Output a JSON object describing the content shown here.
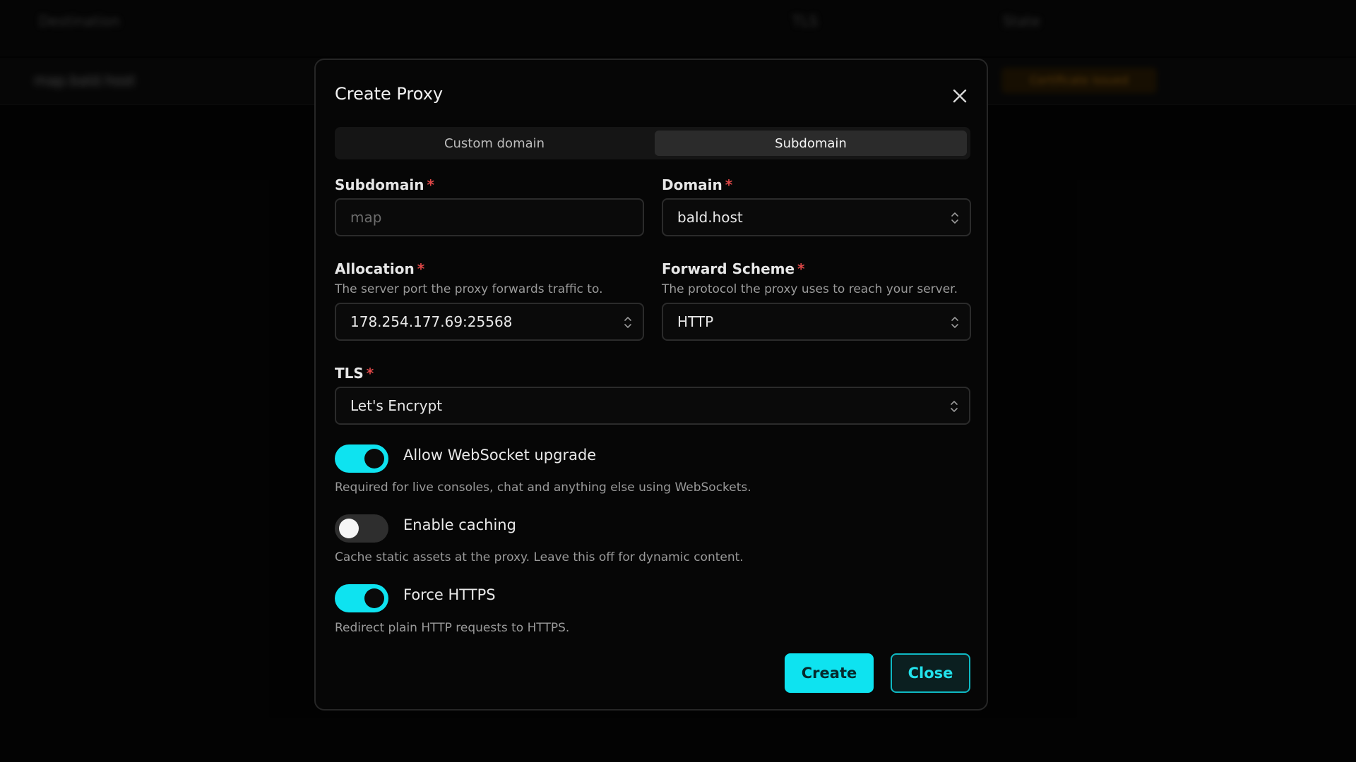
{
  "background": {
    "columns": [
      "Destination",
      "TLS",
      "State"
    ],
    "row_text": "map.bald.host",
    "row_badge": "Certificate Issued"
  },
  "modal": {
    "title": "Create Proxy",
    "close_icon": "close-icon",
    "tabs": [
      {
        "label": "Custom domain",
        "active": false
      },
      {
        "label": "Subdomain",
        "active": true
      }
    ]
  },
  "form": {
    "subdomain": {
      "label": "Subdomain",
      "required_mark": "*",
      "value": "",
      "placeholder": "map"
    },
    "domain": {
      "label": "Domain",
      "required_mark": "*",
      "value": "bald.host"
    },
    "allocation": {
      "label": "Allocation",
      "required_mark": "*",
      "help": "The server port the proxy forwards traffic to.",
      "value": "178.254.177.69:25568"
    },
    "forward_scheme": {
      "label": "Forward Scheme",
      "required_mark": "*",
      "help": "The protocol the proxy uses to reach your server.",
      "value": "HTTP"
    },
    "tls": {
      "label": "TLS",
      "required_mark": "*",
      "value": "Let's Encrypt"
    }
  },
  "toggles": [
    {
      "label": "Allow WebSocket upgrade",
      "help": "Required for live consoles, chat and anything else using WebSockets.",
      "enabled": true
    },
    {
      "label": "Enable caching",
      "help": "Cache static assets at the proxy. Leave this off for dynamic content.",
      "enabled": false
    },
    {
      "label": "Force HTTPS",
      "help": "Redirect plain HTTP requests to HTTPS.",
      "enabled": true
    }
  ],
  "actions": {
    "create_label": "Create",
    "close_label": "Close"
  },
  "colors": {
    "accent": "#0ee3f0",
    "required": "#e04848"
  }
}
